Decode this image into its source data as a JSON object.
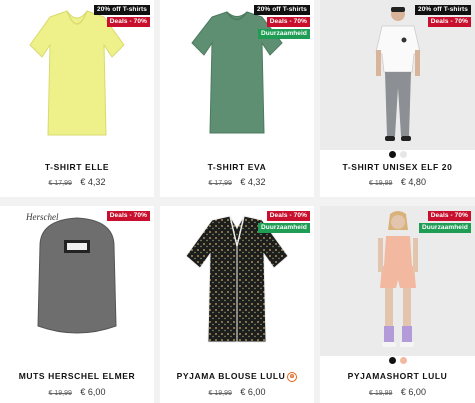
{
  "products": [
    {
      "name": "T-SHIRT ELLE",
      "old_price": "€ 17,99",
      "price": "€ 4,32",
      "badges": [
        "20% off T-shirts",
        "Deals - 70%"
      ]
    },
    {
      "name": "T-SHIRT EVA",
      "old_price": "€ 17,99",
      "price": "€ 4,32",
      "badges": [
        "20% off T-shirts",
        "Deals - 70%",
        "Duurzaamheid"
      ]
    },
    {
      "name": "T-SHIRT UNISEX ELF 20",
      "old_price": "€ 19,99",
      "price": "€ 4,80",
      "badges": [
        "20% off T-shirts",
        "Deals - 70%"
      ]
    },
    {
      "name": "MUTS HERSCHEL ELMER",
      "old_price": "€ 19,99",
      "price": "€ 6,00",
      "badges": [
        "Deals - 70%"
      ]
    },
    {
      "name": "PYJAMA BLOUSE LULU",
      "old_price": "€ 19,99",
      "price": "€ 6,00",
      "badges": [
        "Deals - 70%",
        "Duurzaamheid"
      ]
    },
    {
      "name": "PYJAMASHORT LULU",
      "old_price": "€ 19,99",
      "price": "€ 6,00",
      "badges": [
        "Deals - 70%",
        "Duurzaamheid"
      ]
    }
  ],
  "colors": {
    "yellow_shirt": "#eef08a",
    "green_shirt": "#5f8f72",
    "badge_red": "#c8102e",
    "badge_green": "#1f9d55",
    "badge_black": "#111111"
  },
  "swatches": {
    "elf": [
      "#111111",
      "#e6e6e6"
    ],
    "lulu_short": [
      "#111111",
      "#f2b8a0"
    ]
  }
}
